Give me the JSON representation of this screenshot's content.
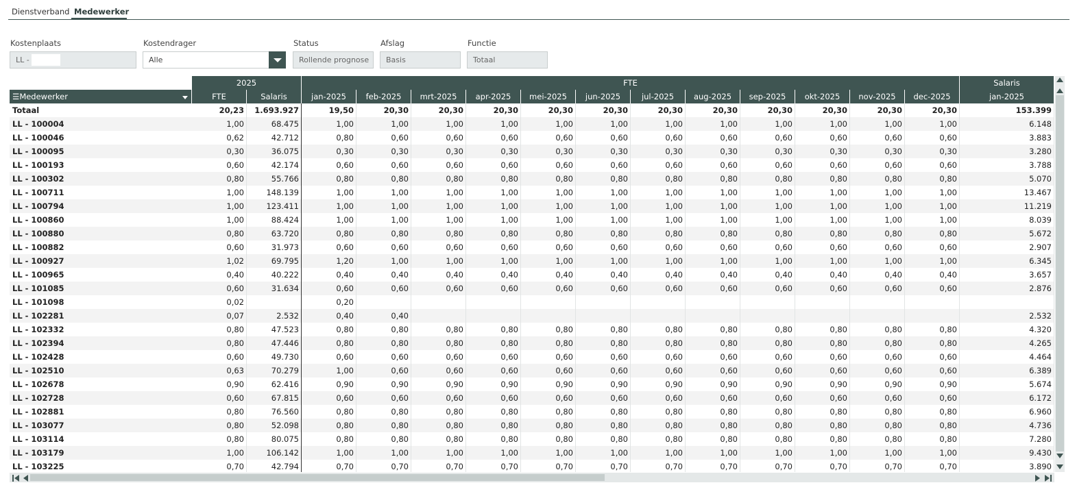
{
  "tabs": [
    {
      "label": "Dienstverband",
      "active": false
    },
    {
      "label": "Medewerker",
      "active": true
    }
  ],
  "filters": {
    "kostenplaats": {
      "label": "Kostenplaats",
      "value": "LL - "
    },
    "kostendrager": {
      "label": "Kostendrager",
      "value": "Alle"
    },
    "status": {
      "label": "Status",
      "value": "Rollende prognose"
    },
    "afslag": {
      "label": "Afslag",
      "value": "Basis"
    },
    "functie": {
      "label": "Functie",
      "value": "Totaal"
    }
  },
  "grid": {
    "group_headers": [
      {
        "label": "2025"
      },
      {
        "label": "FTE"
      },
      {
        "label": "Salaris"
      }
    ],
    "medewerker_label": "Medewerker",
    "columns": [
      "FTE",
      "Salaris",
      "jan-2025",
      "feb-2025",
      "mrt-2025",
      "apr-2025",
      "mei-2025",
      "jun-2025",
      "jul-2025",
      "aug-2025",
      "sep-2025",
      "okt-2025",
      "nov-2025",
      "dec-2025",
      "jan-2025"
    ],
    "rows": [
      {
        "name": "Totaal",
        "vals": [
          "20,23",
          "1.693.927",
          "19,50",
          "20,30",
          "20,30",
          "20,30",
          "20,30",
          "20,30",
          "20,30",
          "20,30",
          "20,30",
          "20,30",
          "20,30",
          "20,30",
          "153.399"
        ]
      },
      {
        "name": "LL - 100004",
        "vals": [
          "1,00",
          "68.475",
          "1,00",
          "1,00",
          "1,00",
          "1,00",
          "1,00",
          "1,00",
          "1,00",
          "1,00",
          "1,00",
          "1,00",
          "1,00",
          "1,00",
          "6.148"
        ]
      },
      {
        "name": "LL - 100046",
        "vals": [
          "0,62",
          "42.712",
          "0,80",
          "0,60",
          "0,60",
          "0,60",
          "0,60",
          "0,60",
          "0,60",
          "0,60",
          "0,60",
          "0,60",
          "0,60",
          "0,60",
          "3.883"
        ]
      },
      {
        "name": "LL - 100095",
        "vals": [
          "0,30",
          "36.075",
          "0,30",
          "0,30",
          "0,30",
          "0,30",
          "0,30",
          "0,30",
          "0,30",
          "0,30",
          "0,30",
          "0,30",
          "0,30",
          "0,30",
          "3.280"
        ]
      },
      {
        "name": "LL - 100193",
        "vals": [
          "0,60",
          "42.174",
          "0,60",
          "0,60",
          "0,60",
          "0,60",
          "0,60",
          "0,60",
          "0,60",
          "0,60",
          "0,60",
          "0,60",
          "0,60",
          "0,60",
          "3.788"
        ]
      },
      {
        "name": "LL - 100302",
        "vals": [
          "0,80",
          "55.766",
          "0,80",
          "0,80",
          "0,80",
          "0,80",
          "0,80",
          "0,80",
          "0,80",
          "0,80",
          "0,80",
          "0,80",
          "0,80",
          "0,80",
          "5.070"
        ]
      },
      {
        "name": "LL - 100711",
        "vals": [
          "1,00",
          "148.139",
          "1,00",
          "1,00",
          "1,00",
          "1,00",
          "1,00",
          "1,00",
          "1,00",
          "1,00",
          "1,00",
          "1,00",
          "1,00",
          "1,00",
          "13.467"
        ]
      },
      {
        "name": "LL - 100794",
        "vals": [
          "1,00",
          "123.411",
          "1,00",
          "1,00",
          "1,00",
          "1,00",
          "1,00",
          "1,00",
          "1,00",
          "1,00",
          "1,00",
          "1,00",
          "1,00",
          "1,00",
          "11.219"
        ]
      },
      {
        "name": "LL - 100860",
        "vals": [
          "1,00",
          "88.424",
          "1,00",
          "1,00",
          "1,00",
          "1,00",
          "1,00",
          "1,00",
          "1,00",
          "1,00",
          "1,00",
          "1,00",
          "1,00",
          "1,00",
          "8.039"
        ]
      },
      {
        "name": "LL - 100880",
        "vals": [
          "0,80",
          "63.720",
          "0,80",
          "0,80",
          "0,80",
          "0,80",
          "0,80",
          "0,80",
          "0,80",
          "0,80",
          "0,80",
          "0,80",
          "0,80",
          "0,80",
          "5.672"
        ]
      },
      {
        "name": "LL - 100882",
        "vals": [
          "0,60",
          "31.973",
          "0,60",
          "0,60",
          "0,60",
          "0,60",
          "0,60",
          "0,60",
          "0,60",
          "0,60",
          "0,60",
          "0,60",
          "0,60",
          "0,60",
          "2.907"
        ]
      },
      {
        "name": "LL - 100927",
        "vals": [
          "1,02",
          "69.795",
          "1,20",
          "1,00",
          "1,00",
          "1,00",
          "1,00",
          "1,00",
          "1,00",
          "1,00",
          "1,00",
          "1,00",
          "1,00",
          "1,00",
          "6.345"
        ]
      },
      {
        "name": "LL - 100965",
        "vals": [
          "0,40",
          "40.222",
          "0,40",
          "0,40",
          "0,40",
          "0,40",
          "0,40",
          "0,40",
          "0,40",
          "0,40",
          "0,40",
          "0,40",
          "0,40",
          "0,40",
          "3.657"
        ]
      },
      {
        "name": "LL - 101085",
        "vals": [
          "0,60",
          "31.634",
          "0,60",
          "0,60",
          "0,60",
          "0,60",
          "0,60",
          "0,60",
          "0,60",
          "0,60",
          "0,60",
          "0,60",
          "0,60",
          "0,60",
          "2.876"
        ]
      },
      {
        "name": "LL - 101098",
        "vals": [
          "0,02",
          "",
          "0,20",
          "",
          "",
          "",
          "",
          "",
          "",
          "",
          "",
          "",
          "",
          "",
          ""
        ]
      },
      {
        "name": "LL - 102281",
        "vals": [
          "0,07",
          "2.532",
          "0,40",
          "0,40",
          "",
          "",
          "",
          "",
          "",
          "",
          "",
          "",
          "",
          "",
          "2.532"
        ]
      },
      {
        "name": "LL - 102332",
        "vals": [
          "0,80",
          "47.523",
          "0,80",
          "0,80",
          "0,80",
          "0,80",
          "0,80",
          "0,80",
          "0,80",
          "0,80",
          "0,80",
          "0,80",
          "0,80",
          "0,80",
          "4.320"
        ]
      },
      {
        "name": "LL - 102394",
        "vals": [
          "0,80",
          "47.446",
          "0,80",
          "0,80",
          "0,80",
          "0,80",
          "0,80",
          "0,80",
          "0,80",
          "0,80",
          "0,80",
          "0,80",
          "0,80",
          "0,80",
          "4.265"
        ]
      },
      {
        "name": "LL - 102428",
        "vals": [
          "0,60",
          "49.730",
          "0,60",
          "0,60",
          "0,60",
          "0,60",
          "0,60",
          "0,60",
          "0,60",
          "0,60",
          "0,60",
          "0,60",
          "0,60",
          "0,60",
          "4.464"
        ]
      },
      {
        "name": "LL - 102510",
        "vals": [
          "0,63",
          "70.279",
          "1,00",
          "0,60",
          "0,60",
          "0,60",
          "0,60",
          "0,60",
          "0,60",
          "0,60",
          "0,60",
          "0,60",
          "0,60",
          "0,60",
          "6.389"
        ]
      },
      {
        "name": "LL - 102678",
        "vals": [
          "0,90",
          "62.416",
          "0,90",
          "0,90",
          "0,90",
          "0,90",
          "0,90",
          "0,90",
          "0,90",
          "0,90",
          "0,90",
          "0,90",
          "0,90",
          "0,90",
          "5.674"
        ]
      },
      {
        "name": "LL - 102728",
        "vals": [
          "0,60",
          "67.815",
          "0,60",
          "0,60",
          "0,60",
          "0,60",
          "0,60",
          "0,60",
          "0,60",
          "0,60",
          "0,60",
          "0,60",
          "0,60",
          "0,60",
          "6.172"
        ]
      },
      {
        "name": "LL - 102881",
        "vals": [
          "0,80",
          "76.560",
          "0,80",
          "0,80",
          "0,80",
          "0,80",
          "0,80",
          "0,80",
          "0,80",
          "0,80",
          "0,80",
          "0,80",
          "0,80",
          "0,80",
          "6.960"
        ]
      },
      {
        "name": "LL - 103077",
        "vals": [
          "0,80",
          "52.098",
          "0,80",
          "0,80",
          "0,80",
          "0,80",
          "0,80",
          "0,80",
          "0,80",
          "0,80",
          "0,80",
          "0,80",
          "0,80",
          "0,80",
          "4.736"
        ]
      },
      {
        "name": "LL - 103114",
        "vals": [
          "0,80",
          "80.075",
          "0,80",
          "0,80",
          "0,80",
          "0,80",
          "0,80",
          "0,80",
          "0,80",
          "0,80",
          "0,80",
          "0,80",
          "0,80",
          "0,80",
          "7.280"
        ]
      },
      {
        "name": "LL - 103179",
        "vals": [
          "1,00",
          "106.142",
          "1,00",
          "1,00",
          "1,00",
          "1,00",
          "1,00",
          "1,00",
          "1,00",
          "1,00",
          "1,00",
          "1,00",
          "1,00",
          "1,00",
          "9.430"
        ]
      },
      {
        "name": "LL - 103225",
        "vals": [
          "0,70",
          "42.794",
          "0,70",
          "0,70",
          "0,70",
          "0,70",
          "0,70",
          "0,70",
          "0,70",
          "0,70",
          "0,70",
          "0,70",
          "0,70",
          "0,70",
          "3.890"
        ]
      }
    ]
  }
}
